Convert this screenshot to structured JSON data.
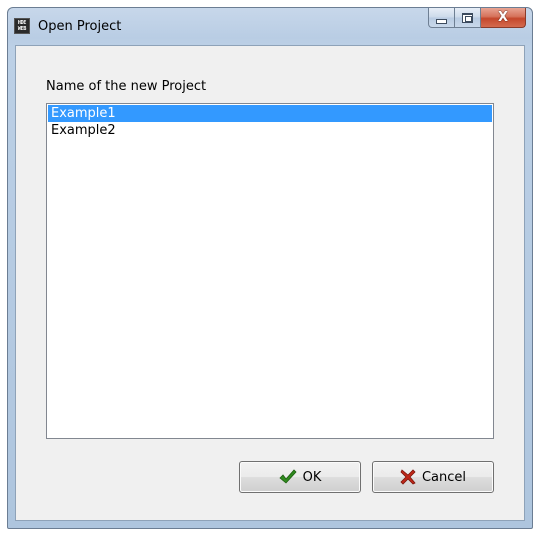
{
  "window": {
    "title": "Open Project",
    "app_icon_lines": [
      "HDE",
      "WEB"
    ]
  },
  "controls": {
    "minimize": "minimize",
    "maximize": "maximize",
    "close": "X"
  },
  "form": {
    "list_label": "Name of the new Project",
    "projects": [
      {
        "name": "Example1",
        "selected": true
      },
      {
        "name": "Example2",
        "selected": false
      }
    ]
  },
  "buttons": {
    "ok_label": "OK",
    "cancel_label": "Cancel"
  },
  "colors": {
    "selection": "#3399ff",
    "check_icon": "#2f8a1e",
    "cancel_icon": "#c0281a"
  },
  "icons": {
    "ok": "check-icon",
    "cancel": "x-icon"
  }
}
